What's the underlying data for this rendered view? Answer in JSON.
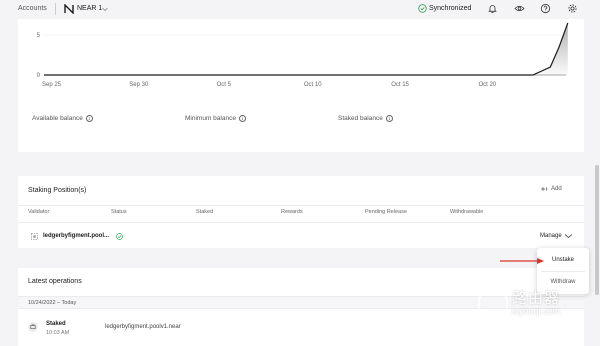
{
  "topbar": {
    "accounts_label": "Accounts",
    "account_name": "NEAR 1",
    "sync_status": "Synchronized"
  },
  "chart_data": {
    "type": "line",
    "x_ticks": [
      "Sep 25",
      "Sep 30",
      "Oct 5",
      "Oct 10",
      "Oct 15",
      "Oct 20"
    ],
    "y_ticks": [
      0,
      5
    ],
    "ylim": [
      0,
      6.5
    ],
    "series": [
      {
        "values_x_day_index": [
          0,
          28,
          29,
          29.5,
          30
        ],
        "values": [
          0,
          0,
          1,
          3.5,
          6.5
        ]
      }
    ],
    "accent_color": "#1c1c1e"
  },
  "balances": {
    "available": "Available balance",
    "minimum": "Minimum balance",
    "staked": "Staked balance"
  },
  "staking": {
    "title": "Staking Position(s)",
    "add_label": "Add",
    "headers": [
      "Validator",
      "Status",
      "Staked",
      "Rewards",
      "Pending Release",
      "Withdrawable"
    ],
    "row": {
      "validator": "ledgerbyfigment.pool...",
      "manage_label": "Manage"
    }
  },
  "dropdown": {
    "items": [
      "Unstake",
      "Withdraw"
    ]
  },
  "operations": {
    "title": "Latest operations",
    "date_range": "10/24/2022 – Today",
    "row": {
      "type": "Staked",
      "time": "10:03 AM",
      "target": "ledgerbyfigment.poolv1.near"
    }
  },
  "watermark": {
    "text": "路由器",
    "sub": "luyouqi.com"
  }
}
